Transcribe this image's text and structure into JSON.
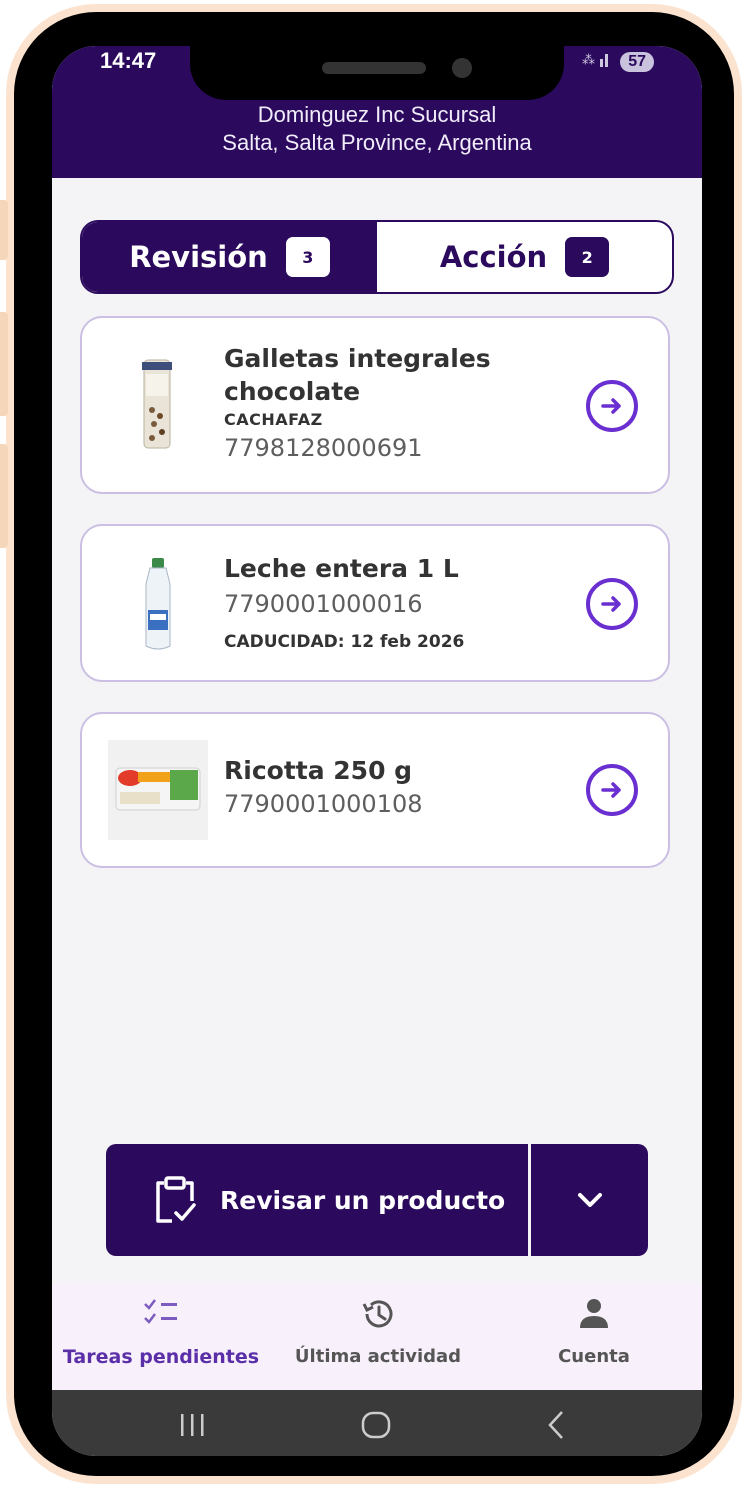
{
  "status_bar": {
    "time": "14:47",
    "signal_text": "##.ıl",
    "battery": "57"
  },
  "header": {
    "store_name": "Dominguez Inc Sucursal",
    "store_location": "Salta, Salta Province, Argentina"
  },
  "tabs": [
    {
      "label": "Revisión",
      "count": "3",
      "active": true
    },
    {
      "label": "Acción",
      "count": "2",
      "active": false
    }
  ],
  "products": [
    {
      "title_line1": "Galletas integrales",
      "title_line2": "chocolate",
      "brand": "CACHAFAZ",
      "code": "7798128000691"
    },
    {
      "title_line1": "Leche entera 1 L",
      "code": "7790001000016",
      "expiry": "CADUCIDAD: 12 feb 2026"
    },
    {
      "title_line1": "Ricotta 250 g",
      "code": "7790001000108"
    }
  ],
  "primary_action": {
    "label": "Revisar un producto"
  },
  "bottom_nav": [
    {
      "label": "Tareas pendientes",
      "icon": "task-list-icon",
      "active": true
    },
    {
      "label": "Última actividad",
      "icon": "history-icon",
      "active": false
    },
    {
      "label": "Cuenta",
      "icon": "person-icon",
      "active": false
    }
  ],
  "colors": {
    "brand": "#2b0a5e",
    "accent": "#6a2fd1",
    "frame": "#fbe3cf"
  }
}
